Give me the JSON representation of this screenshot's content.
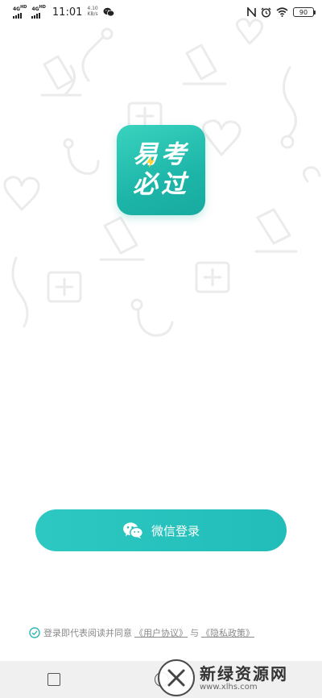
{
  "status_bar": {
    "network1": "4G",
    "network1_sup": "HD",
    "network2": "4G",
    "network2_sup": "HD",
    "time": "11:01",
    "speed_value": "4.10",
    "speed_unit": "KB/s",
    "battery": "90"
  },
  "logo": {
    "line1": "易考",
    "line2": "必过",
    "accent_color": "#1fbfae"
  },
  "login": {
    "button_label": "微信登录",
    "button_color": "#26c1bd"
  },
  "agreement": {
    "prefix": "登录即代表阅读并同意",
    "user_agreement": "《用户协议》",
    "joiner": "与",
    "privacy_policy": "《隐私政策》"
  },
  "watermark": {
    "title": "新绿资源网",
    "url": "www.xlhs.com"
  }
}
